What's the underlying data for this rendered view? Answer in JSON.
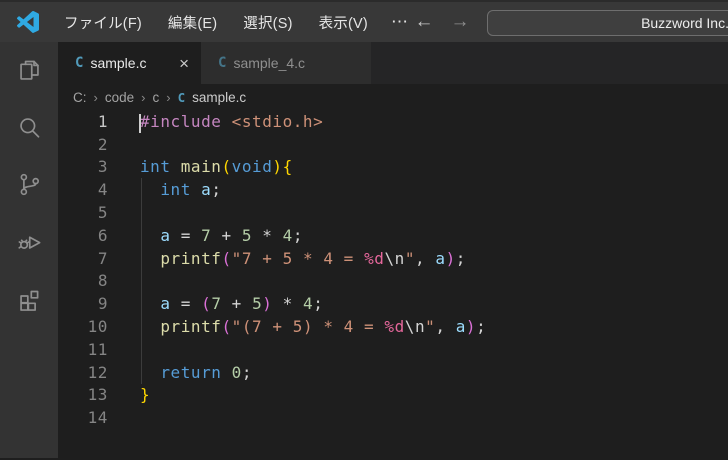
{
  "window": {
    "title": "Buzzword Inc."
  },
  "title_bar": {
    "menus": [
      {
        "label": "ファイル(F)"
      },
      {
        "label": "編集(E)"
      },
      {
        "label": "選択(S)"
      },
      {
        "label": "表示(V)"
      },
      {
        "label": "⋯",
        "overflow": true
      }
    ],
    "back_arrow": "←",
    "forward_arrow": "→",
    "command_center_text": "Buzzword Inc."
  },
  "activity_bar": {
    "items": [
      {
        "name": "explorer"
      },
      {
        "name": "search"
      },
      {
        "name": "source-control"
      },
      {
        "name": "run-and-debug"
      },
      {
        "name": "extensions"
      }
    ]
  },
  "tab_bar": {
    "tabs": [
      {
        "label": "sample.c",
        "icon": "C",
        "active": true,
        "close_label": "×"
      },
      {
        "label": "sample_4.c",
        "icon": "C",
        "active": false
      }
    ]
  },
  "breadcrumb": {
    "segments": [
      "C:",
      "code",
      "c"
    ],
    "separator": "›",
    "file_icon": "C",
    "file": "sample.c"
  },
  "editor": {
    "language": "c",
    "active_line": 1,
    "lines": [
      {
        "num": "1",
        "cursor": true,
        "tokens": [
          [
            "preprocessor",
            "#include"
          ],
          [
            "plain",
            " "
          ],
          [
            "string",
            "<stdio.h>"
          ]
        ]
      },
      {
        "num": "2",
        "tokens": []
      },
      {
        "num": "3",
        "tokens": [
          [
            "keyword",
            "int"
          ],
          [
            "plain",
            " "
          ],
          [
            "function",
            "main"
          ],
          [
            "bracket1",
            "("
          ],
          [
            "keyword",
            "void"
          ],
          [
            "bracket1",
            ")"
          ],
          [
            "bracket1",
            "{"
          ]
        ]
      },
      {
        "num": "4",
        "tokens": [
          [
            "plain",
            "  "
          ],
          [
            "keyword",
            "int"
          ],
          [
            "plain",
            " "
          ],
          [
            "variable",
            "a"
          ],
          [
            "plain",
            ";"
          ]
        ]
      },
      {
        "num": "5",
        "tokens": []
      },
      {
        "num": "6",
        "tokens": [
          [
            "plain",
            "  "
          ],
          [
            "variable",
            "a"
          ],
          [
            "plain",
            " = "
          ],
          [
            "number",
            "7"
          ],
          [
            "plain",
            " + "
          ],
          [
            "number",
            "5"
          ],
          [
            "plain",
            " * "
          ],
          [
            "number",
            "4"
          ],
          [
            "plain",
            ";"
          ]
        ]
      },
      {
        "num": "7",
        "tokens": [
          [
            "plain",
            "  "
          ],
          [
            "function",
            "printf"
          ],
          [
            "bracket2",
            "("
          ],
          [
            "string",
            "\"7 + 5 * 4 = "
          ],
          [
            "format",
            "%d"
          ],
          [
            "escape",
            "\\n"
          ],
          [
            "string",
            "\""
          ],
          [
            "plain",
            ", "
          ],
          [
            "variable",
            "a"
          ],
          [
            "bracket2",
            ")"
          ],
          [
            "plain",
            ";"
          ]
        ]
      },
      {
        "num": "8",
        "tokens": []
      },
      {
        "num": "9",
        "tokens": [
          [
            "plain",
            "  "
          ],
          [
            "variable",
            "a"
          ],
          [
            "plain",
            " = "
          ],
          [
            "bracket2",
            "("
          ],
          [
            "number",
            "7"
          ],
          [
            "plain",
            " + "
          ],
          [
            "number",
            "5"
          ],
          [
            "bracket2",
            ")"
          ],
          [
            "plain",
            " * "
          ],
          [
            "number",
            "4"
          ],
          [
            "plain",
            ";"
          ]
        ]
      },
      {
        "num": "10",
        "tokens": [
          [
            "plain",
            "  "
          ],
          [
            "function",
            "printf"
          ],
          [
            "bracket2",
            "("
          ],
          [
            "string",
            "\"(7 + 5) * 4 = "
          ],
          [
            "format",
            "%d"
          ],
          [
            "escape",
            "\\n"
          ],
          [
            "string",
            "\""
          ],
          [
            "plain",
            ", "
          ],
          [
            "variable",
            "a"
          ],
          [
            "bracket2",
            ")"
          ],
          [
            "plain",
            ";"
          ]
        ]
      },
      {
        "num": "11",
        "tokens": []
      },
      {
        "num": "12",
        "tokens": [
          [
            "plain",
            "  "
          ],
          [
            "keyword",
            "return"
          ],
          [
            "plain",
            " "
          ],
          [
            "number",
            "0"
          ],
          [
            "plain",
            ";"
          ]
        ]
      },
      {
        "num": "13",
        "tokens": [
          [
            "bracket1",
            "}"
          ]
        ]
      },
      {
        "num": "14",
        "tokens": []
      }
    ]
  },
  "colors": {
    "accent_blue": "#2fa9e2",
    "c_file": "#519aba",
    "plain": "#d4d4d4",
    "keyword": "#569cd6",
    "preprocessor": "#c586c0",
    "function": "#dcdcaa",
    "string": "#ce9178",
    "number": "#b5cea8",
    "variable": "#9cdcfe",
    "format": "#e5679b",
    "escape": "#d4d4d4",
    "bracket1": "#ffd700",
    "bracket2": "#da70d6",
    "line_number": "#858585",
    "active_line_number": "#c6c6c6"
  }
}
